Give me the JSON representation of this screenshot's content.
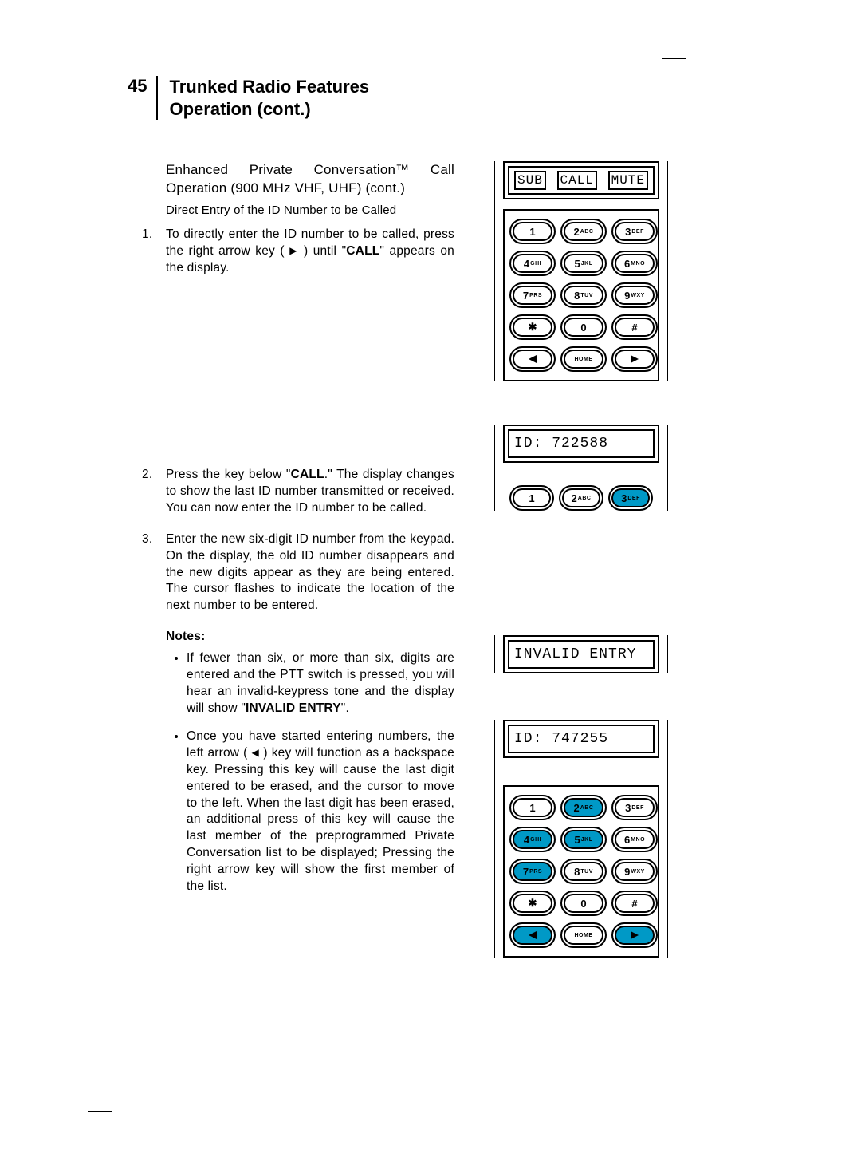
{
  "page_number": "45",
  "page_title": "Trunked Radio Features Operation (cont.)",
  "subheading1": "Enhanced Private Conversation™ Call Operation (900 MHz VHF, UHF) (cont.)",
  "subheading2": "Direct Entry of the ID Number to be Called",
  "steps": {
    "s1a": "To directly enter the ID number to be called, press the right arrow key ( ",
    "s1b": " ) until \"",
    "s1c": "CALL",
    "s1d": "\" appears on the display.",
    "s2a": "Press the key below \"",
    "s2b": "CALL",
    "s2c": ".\" The display changes to show the last ID number transmitted or received. You can now enter the ID number to be called.",
    "s3": "Enter the new six-digit ID number from the keypad. On the display, the old ID number disappears and the new digits appear as they are being entered. The cursor flashes to indicate the location of the next number to be entered."
  },
  "notes_label": "Notes:",
  "notes": {
    "n1a": "If fewer than six, or more than six, digits are entered and the PTT switch is pressed, you will hear an invalid-keypress tone and the display will show \"",
    "n1b": "INVALID ENTRY",
    "n1c": "\".",
    "n2a": "Once you have started entering numbers, the left arrow ( ",
    "n2b": " ) key will function as a backspace key. Pressing this key will cause the last digit entered to be erased, and the cursor to move to the left. When the last digit has been erased, an additional press of this key will cause the last member of the preprogrammed Private Conversation list to be displayed; Pressing the right arrow key will show the first member of the list."
  },
  "fig1": {
    "tags": [
      "SUB",
      "CALL",
      "MUTE"
    ],
    "keys": {
      "k1": "1",
      "k2n": "2",
      "k2l": "ABC",
      "k3n": "3",
      "k3l": "DEF",
      "k4n": "4",
      "k4l": "GHI",
      "k5n": "5",
      "k5l": "JKL",
      "k6n": "6",
      "k6l": "MNO",
      "k7n": "7",
      "k7l": "PRS",
      "k8n": "8",
      "k8l": "TUV",
      "k9n": "9",
      "k9l": "WXY",
      "kstar": "✱",
      "k0": "0",
      "khash": "#",
      "home": "HOME"
    }
  },
  "fig2": {
    "display": "ID: 722588"
  },
  "fig3": {
    "display": "INVALID ENTRY"
  },
  "fig4": {
    "display": "ID: 747255",
    "highlight_keys": [
      "2",
      "4",
      "5",
      "7"
    ],
    "highlight_arrows": true
  }
}
